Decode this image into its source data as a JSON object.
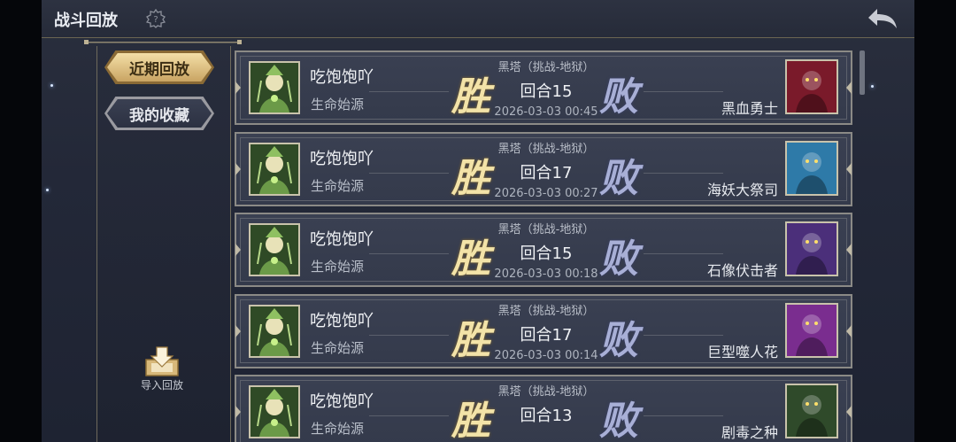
{
  "header": {
    "title": "战斗回放"
  },
  "sidebar": {
    "tabs": [
      {
        "label": "近期回放",
        "active": true
      },
      {
        "label": "我的收藏",
        "active": false
      }
    ],
    "import_label": "导入回放"
  },
  "records": [
    {
      "player": "吃饱饱吖",
      "role": "生命始源",
      "win": "胜",
      "mode": "黑塔（挑战-地狱）",
      "round": "回合15",
      "time": "2026-03-03 00:45",
      "lose": "败",
      "opponent": "黑血勇士",
      "opp_icon": "dark-knight-icon",
      "opp_color": "#7a1a2a"
    },
    {
      "player": "吃饱饱吖",
      "role": "生命始源",
      "win": "胜",
      "mode": "黑塔（挑战-地狱）",
      "round": "回合17",
      "time": "2026-03-03 00:27",
      "lose": "败",
      "opponent": "海妖大祭司",
      "opp_icon": "siren-priest-icon",
      "opp_color": "#2e7aa8"
    },
    {
      "player": "吃饱饱吖",
      "role": "生命始源",
      "win": "胜",
      "mode": "黑塔（挑战-地狱）",
      "round": "回合15",
      "time": "2026-03-03 00:18",
      "lose": "败",
      "opponent": "石像伏击者",
      "opp_icon": "gargoyle-icon",
      "opp_color": "#4b2f7a"
    },
    {
      "player": "吃饱饱吖",
      "role": "生命始源",
      "win": "胜",
      "mode": "黑塔（挑战-地狱）",
      "round": "回合17",
      "time": "2026-03-03 00:14",
      "lose": "败",
      "opponent": "巨型噬人花",
      "opp_icon": "maneater-flower-icon",
      "opp_color": "#7a2d8f"
    },
    {
      "player": "吃饱饱吖",
      "role": "生命始源",
      "win": "胜",
      "mode": "黑塔（挑战-地狱）",
      "round": "回合13",
      "time": "",
      "lose": "败",
      "opponent": "剧毒之种",
      "opp_icon": "toxic-seed-icon",
      "opp_color": "#2f4a2a"
    }
  ]
}
